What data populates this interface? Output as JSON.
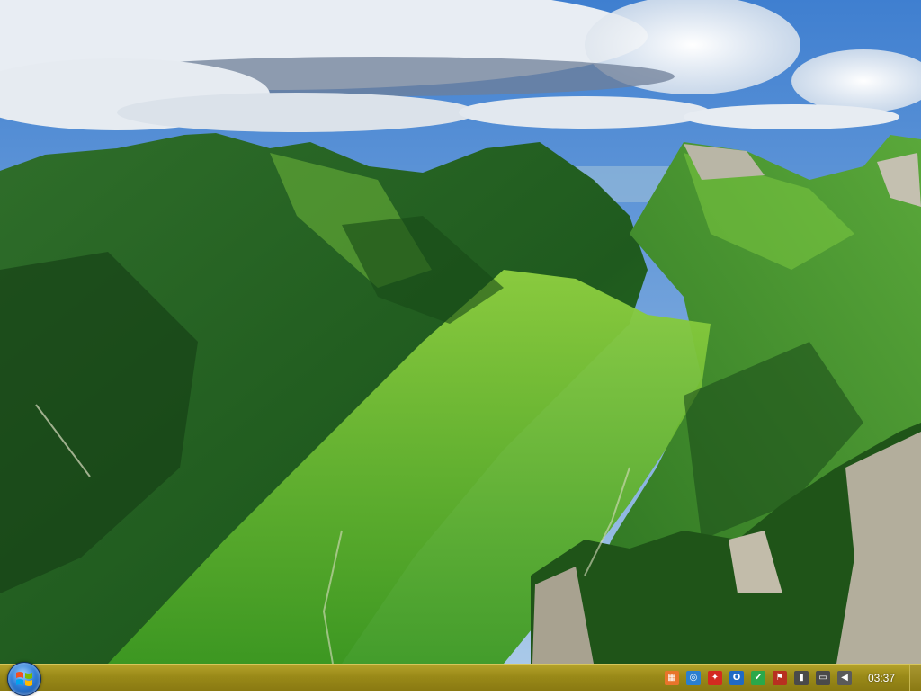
{
  "desktop": {
    "wallpaper": "alpine-valley-landscape"
  },
  "taskbar": {
    "start_button": {
      "icon": "windows-logo-icon"
    },
    "tray_icons": [
      {
        "name": "office-app-icon",
        "color": "#e8742a",
        "glyph": "▦"
      },
      {
        "name": "network-globe-icon",
        "color": "#2a7fd0",
        "glyph": "◎"
      },
      {
        "name": "pdf-reader-icon",
        "color": "#d42a20",
        "glyph": "✦"
      },
      {
        "name": "outlook-icon",
        "color": "#1f6ac4",
        "glyph": "O"
      },
      {
        "name": "security-shield-icon",
        "color": "#2aa84a",
        "glyph": "✔"
      },
      {
        "name": "action-center-flag-icon",
        "color": "#b83020",
        "glyph": "⚑"
      },
      {
        "name": "safely-remove-hardware-icon",
        "color": "#4a4a4a",
        "glyph": "▮"
      },
      {
        "name": "network-monitor-icon",
        "color": "#4a4a4a",
        "glyph": "▭"
      },
      {
        "name": "volume-speaker-icon",
        "color": "#5a5a5a",
        "glyph": "◀"
      }
    ],
    "clock": "03:37"
  }
}
